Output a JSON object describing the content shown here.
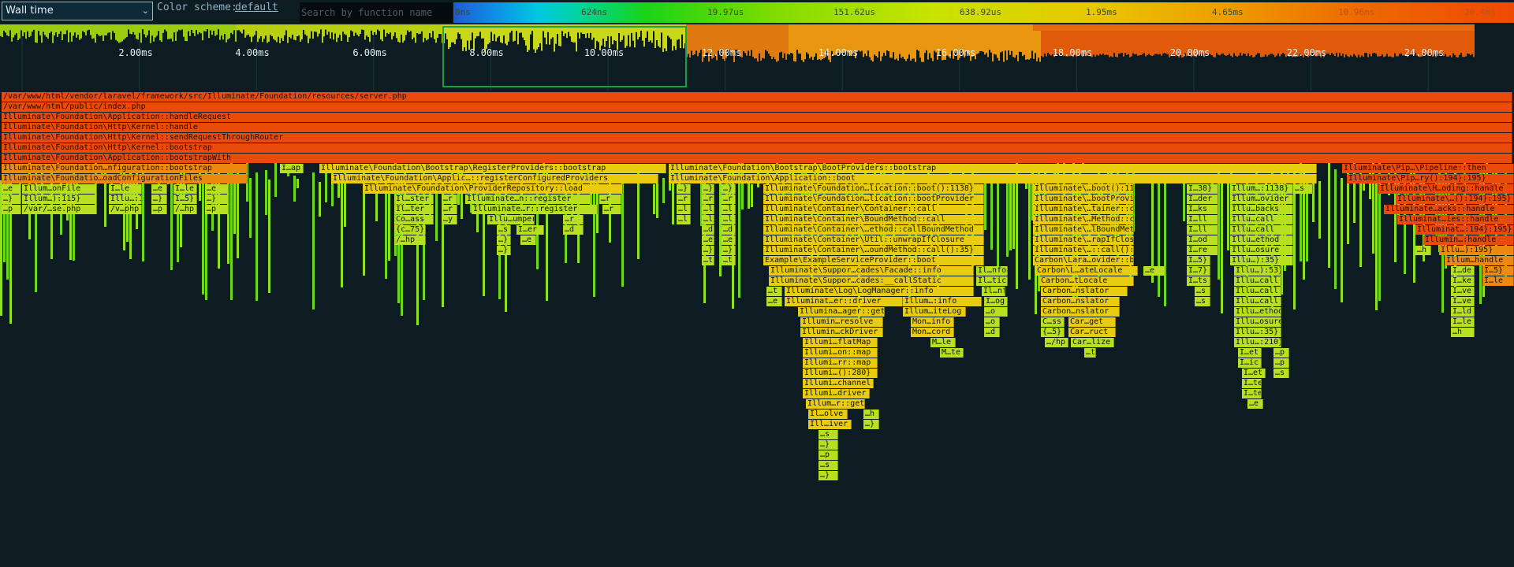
{
  "toolbar": {
    "view_select_value": "Wall time",
    "color_scheme_label": "Color scheme:",
    "color_scheme_value": "default",
    "search_placeholder": "Search by function name",
    "legend_ticks": [
      "0ns",
      "624ns",
      "19.97us",
      "151.62us",
      "638.92us",
      "1.95ms",
      "4.65ms",
      "10.96ms",
      "20.4ms"
    ]
  },
  "overview": {
    "time_labels": [
      "2.00ms",
      "4.00ms",
      "6.00ms",
      "8.00ms",
      "10.00ms",
      "12.00ms",
      "14.00ms",
      "16.00ms",
      "18.00ms",
      "20.00ms",
      "22.00ms",
      "24.00ms"
    ]
  },
  "flamegraph": {
    "stack_frames": [
      "/var/www/html/vendor/laravel/framework/src/Illuminate/Foundation/resources/server.php",
      "/var/www/html/public/index.php",
      "Illuminate\\Foundation\\Application::handleRequest",
      "Illuminate\\Foundation\\Http\\Kernel::handle",
      "Illuminate\\Foundation\\Http\\Kernel::sendRequestThroughRouter",
      "Illuminate\\Foundation\\Http\\Kernel::bootstrap",
      "Illuminate\\Foundation\\Application::bootstrapWith"
    ],
    "row7": [
      "Illuminate\\Foundation…nfiguration::bootstrap",
      "I…ap",
      "Illuminate\\Foundation\\Bootstrap\\RegisterProviders::bootstrap",
      "Illuminate\\Foundation\\Bootstrap\\BootProviders::bootstrap",
      "Illuminate\\Pip…\\Pipeline::then"
    ],
    "row8": [
      "Illuminate\\Foundatio…oadConfigurationFiles",
      "Illuminate\\Foundation\\Applic…::registerConfiguredProviders",
      "Illuminate\\Foundation\\Application::boot",
      "Illuminate\\Pip…ry():194}:195}"
    ],
    "row9": [
      "…e",
      "Illum…onFile",
      "I…le",
      "…e",
      "I…le",
      "…e",
      "Illuminate\\Foundation\\ProviderRepository::load",
      "…}",
      "…}",
      "…}",
      "Illuminate\\Foundation…lication::boot():1138}",
      "Illuminate\\…boot():1138}",
      "I…38}",
      "Illum…:1138}",
      "…s",
      "Illuminate\\H…oding::handle"
    ],
    "row10": [
      "…}",
      "Illum…):115}",
      "Illu…:115}",
      "…}",
      "I…5}",
      "…}",
      "Il…ster",
      "…r",
      "Illuminate…n::register",
      "…r",
      "…r",
      "…r",
      "…r",
      "Illuminate\\Foundation…lication::bootProvider",
      "Illuminate\\…bootProvider",
      "I…der",
      "Illum…ovider",
      "Illuminate\\…():194}:195}"
    ],
    "row11": [
      "…p",
      "/var/…se.php",
      "/v…php",
      "…p",
      "/…hp",
      "…p",
      "Il…ter",
      "…r",
      "Illuminate…r::register",
      "…r",
      "…l",
      "…l",
      "…l",
      "Illuminate\\Container\\Container::call",
      "Illuminate\\…tainer::call",
      "I…ks",
      "Illu…backs",
      "Illuminate…acks::handle"
    ],
    "row12": [
      "Co…ass",
      "…y",
      "Illu…umper",
      "…r",
      "…l",
      "…l",
      "…l",
      "Illuminate\\Container\\BoundMethod::call",
      "Illuminate\\…Method::call",
      "I…ll",
      "Illu…call",
      "Illuminat…ies::handle"
    ],
    "row13": [
      "{c…75}",
      "…s",
      "I…er",
      "…d",
      "…d",
      "…d",
      "Illuminate\\Container\\…ethod::callBoundMethod",
      "Illuminate\\…lBoundMethod",
      "I…ll",
      "Illu…call",
      "Illuminat…:194}:195}"
    ],
    "row14": [
      "/…hp",
      "…}",
      "…e",
      "…e",
      "…e",
      "Illuminate\\Container\\Util::unwrapIfClosure",
      "Illuminate\\…rapIfClosure",
      "I…od",
      "Illu…ethod",
      "Illumin…:handle"
    ],
    "row15": [
      "…p",
      "…}",
      "…}",
      "…}",
      "Illuminate\\Container\\…oundMethod::call():35}",
      "Illuminate\\…::call():35}",
      "I…re",
      "Illu…osure",
      "…h",
      "Illu…):195}"
    ],
    "row16": [
      "…t",
      "…t",
      "…t",
      "Example\\ExampleServiceProvider::boot",
      "Carbon\\Lara…ovider::boot",
      "I…5}",
      "Illu…):35}",
      "Illum…handle"
    ],
    "row17": [
      "Illuminate\\Suppor…cades\\Facade::info",
      "Il…nfo",
      "Carbon\\L…ateLocale",
      "…e",
      "I…7}",
      "Illu…):53}",
      "I…de",
      "I…5}"
    ],
    "row18": [
      "Illuminate\\Suppor…cades:__callStatic",
      "Il…tic",
      "Carbon…tLocale",
      "I…ts",
      "Illu…call",
      "I…ke",
      "I…le"
    ],
    "row19": [
      "…t",
      "Illuminate\\Log\\LogManager::info",
      "Il…nfo",
      "Carbon…nslator",
      "…s",
      "Illu…call",
      "I…ve"
    ],
    "row20": [
      "…e",
      "Illuminat…er::driver",
      "Illum…:info",
      "I…og",
      "Carbon…nslator",
      "…s",
      "Illu…call",
      "I…ve"
    ],
    "row21": [
      "Illumina…ager::get",
      "Illum…iteLog",
      "…o",
      "Carbon…nslator",
      "Illu…ethod",
      "I…ld"
    ],
    "row22": [
      "Illumin…resolve",
      "Mon…info",
      "…o",
      "C…ss",
      "Car…get",
      "Illu…osure",
      "I…le"
    ],
    "row23": [
      "Illumin…ckDriver",
      "Mon…cord",
      "…d",
      "{…5}",
      "Car…ruct",
      "Illu…:35}",
      "…h"
    ],
    "row24": [
      "Illumi…flatMap",
      "M…le",
      "…/hp",
      "Car…lize",
      "Illu…:210}"
    ],
    "row25": [
      "Illumi…on::map",
      "M…te",
      "…t",
      "I…et",
      "…p"
    ],
    "row26": [
      "Illumi…rr::map",
      "I…ic",
      "…p"
    ],
    "row27": [
      "Illumi…():280}",
      "I…et",
      "…s"
    ],
    "row28": [
      "Illumi…channel",
      "I…te"
    ],
    "row29": [
      "Illumi…driver",
      "I…te"
    ],
    "row30": [
      "Illum…r::get",
      "…e"
    ],
    "row31": [
      "Il…olve",
      "…h"
    ],
    "row32": [
      "Ill…iver",
      "…}"
    ],
    "row33": [
      "…s"
    ],
    "row34": [
      "…}"
    ],
    "row35": [
      "…p"
    ],
    "row36": [
      "…s"
    ],
    "row37": [
      "…}"
    ]
  },
  "colors": {
    "background": "#0d1b22",
    "frame_red": "#ea4a0a",
    "frame_orange": "#ec8a10",
    "frame_yellow": "#e8cc10",
    "frame_lime": "#b8e020",
    "frame_green": "#6cd81a",
    "selection": "#18a048"
  }
}
